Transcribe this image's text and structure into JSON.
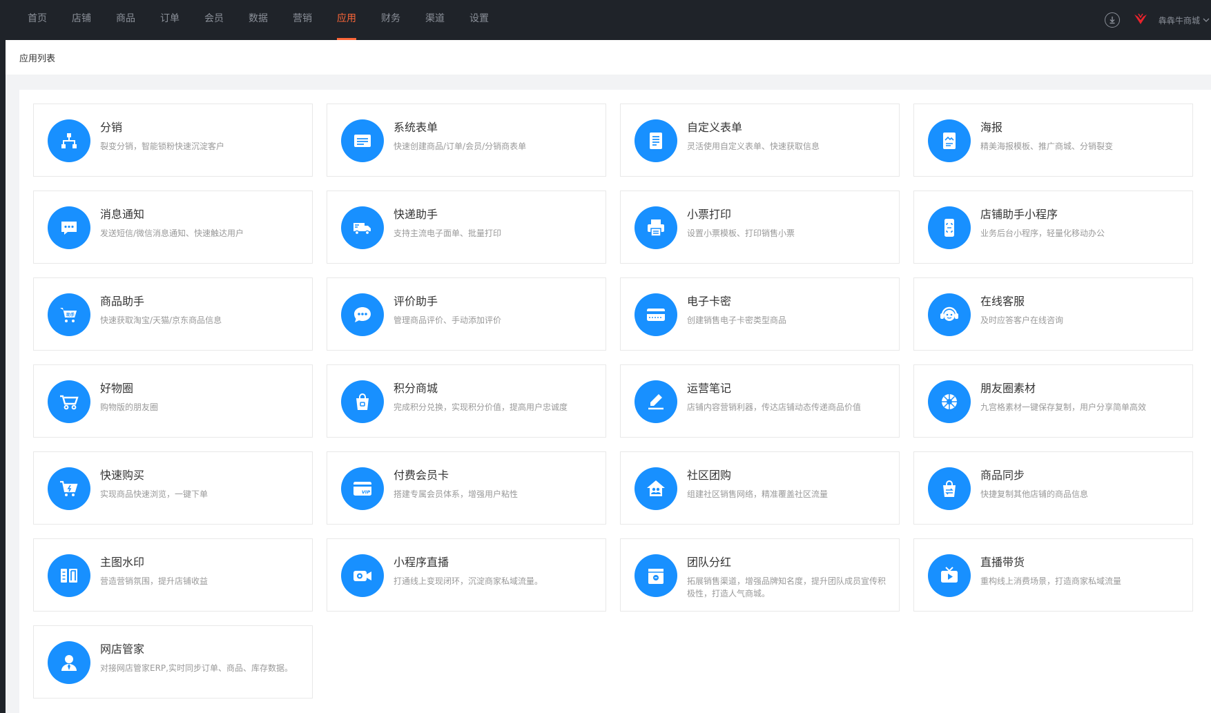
{
  "nav": {
    "items": [
      {
        "label": "首页"
      },
      {
        "label": "店铺"
      },
      {
        "label": "商品"
      },
      {
        "label": "订单"
      },
      {
        "label": "会员"
      },
      {
        "label": "数据"
      },
      {
        "label": "营销"
      },
      {
        "label": "应用"
      },
      {
        "label": "财务"
      },
      {
        "label": "渠道"
      },
      {
        "label": "设置"
      }
    ],
    "active_label": "应用",
    "shop_name": "犇犇牛商城"
  },
  "colors": {
    "accent": "#fb6638",
    "icon_bg": "#1890ff",
    "topbar_bg": "#1f2329"
  },
  "page": {
    "title": "应用列表"
  },
  "apps": [
    {
      "title": "分销",
      "desc": "裂变分销，智能锁粉快速沉淀客户",
      "icon": "org-chart-icon"
    },
    {
      "title": "系统表单",
      "desc": "快速创建商品/订单/会员/分销商表单",
      "icon": "form-list-icon"
    },
    {
      "title": "自定义表单",
      "desc": "灵活使用自定义表单、快速获取信息",
      "icon": "document-icon"
    },
    {
      "title": "海报",
      "desc": "精美海报模板、推广商城、分销裂变",
      "icon": "poster-icon"
    },
    {
      "title": "消息通知",
      "desc": "发送短信/微信消息通知、快速触达用户",
      "icon": "message-icon"
    },
    {
      "title": "快递助手",
      "desc": "支持主流电子面单、批量打印",
      "icon": "truck-icon"
    },
    {
      "title": "小票打印",
      "desc": "设置小票模板、打印销售小票",
      "icon": "printer-icon"
    },
    {
      "title": "店铺助手小程序",
      "desc": "业务后台小程序，轻量化移动办公",
      "icon": "phone-scan-icon"
    },
    {
      "title": "商品助手",
      "desc": "快速获取淘宝/天猫/京东商品信息",
      "icon": "cart-helper-icon",
      "badge": "助手"
    },
    {
      "title": "评价助手",
      "desc": "管理商品评价、手动添加评价",
      "icon": "chat-bubble-icon"
    },
    {
      "title": "电子卡密",
      "desc": "创建销售电子卡密类型商品",
      "icon": "card-icon"
    },
    {
      "title": "在线客服",
      "desc": "及时应答客户在线咨询",
      "icon": "headset-icon"
    },
    {
      "title": "好物圈",
      "desc": "购物版的朋友圈",
      "icon": "basket-icon"
    },
    {
      "title": "积分商城",
      "desc": "完成积分兑换，实现积分价值，提高用户忠诚度",
      "icon": "shopping-bag-icon"
    },
    {
      "title": "运营笔记",
      "desc": "店铺内容营销利器，传达店铺动态传递商品价值",
      "icon": "pen-note-icon"
    },
    {
      "title": "朋友圈素材",
      "desc": "九宫格素材一键保存复制，用户分享简单高效",
      "icon": "aperture-icon"
    },
    {
      "title": "快速购买",
      "desc": "实现商品快速浏览，一键下单",
      "icon": "cart-flash-icon"
    },
    {
      "title": "付费会员卡",
      "desc": "搭建专属会员体系，增强用户粘性",
      "icon": "vip-card-icon",
      "badge": "VIP"
    },
    {
      "title": "社区团购",
      "desc": "组建社区销售网络，精准覆盖社区流量",
      "icon": "community-house-icon"
    },
    {
      "title": "商品同步",
      "desc": "快捷复制其他店铺的商品信息",
      "icon": "sync-bag-icon"
    },
    {
      "title": "主图水印",
      "desc": "营造营销氛围，提升店铺收益",
      "icon": "watermark-icon",
      "badge": "印"
    },
    {
      "title": "小程序直播",
      "desc": "打通线上变现闭环，沉淀商家私域流量。",
      "icon": "video-camera-icon"
    },
    {
      "title": "团队分红",
      "desc": "拓展销售渠道，增强品牌知名度，提升团队成员宣传积极性，打造人气商城。",
      "icon": "team-dividend-icon"
    },
    {
      "title": "直播带货",
      "desc": "重构线上消费场景，打造商家私域流量",
      "icon": "tv-play-icon"
    },
    {
      "title": "网店管家",
      "desc": "对接网店管家ERP,实时同步订单、商品、库存数据。",
      "icon": "manager-person-icon"
    }
  ]
}
